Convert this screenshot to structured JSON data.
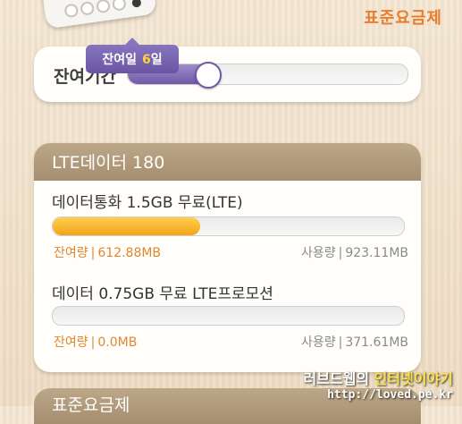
{
  "header": {
    "plan_name": "표준요금제"
  },
  "remaining_period": {
    "label": "잔여기간",
    "progress_fraction": 0.28,
    "tooltip_prefix": "잔여일",
    "tooltip_days": "6",
    "tooltip_suffix": "일"
  },
  "lte_data": {
    "title": "LTE데이터 180",
    "items": [
      {
        "title": "데이터통화 1.5GB 무료(LTE)",
        "progress_fraction": 0.42,
        "remain_label": "잔여량",
        "remain_value": "612.88MB",
        "used_label": "사용량",
        "used_value": "923.11MB"
      },
      {
        "title": "데이터 0.75GB 무료 LTE프로모션",
        "progress_fraction": 0.0,
        "remain_label": "잔여량",
        "remain_value": "0.0MB",
        "used_label": "사용량",
        "used_value": "371.61MB"
      }
    ]
  },
  "next_section": {
    "title": "표준요금제"
  },
  "watermark": {
    "part1": "러브드웹의 ",
    "part2": "인터넷이야기",
    "url": "http://loved.pe.kr"
  }
}
